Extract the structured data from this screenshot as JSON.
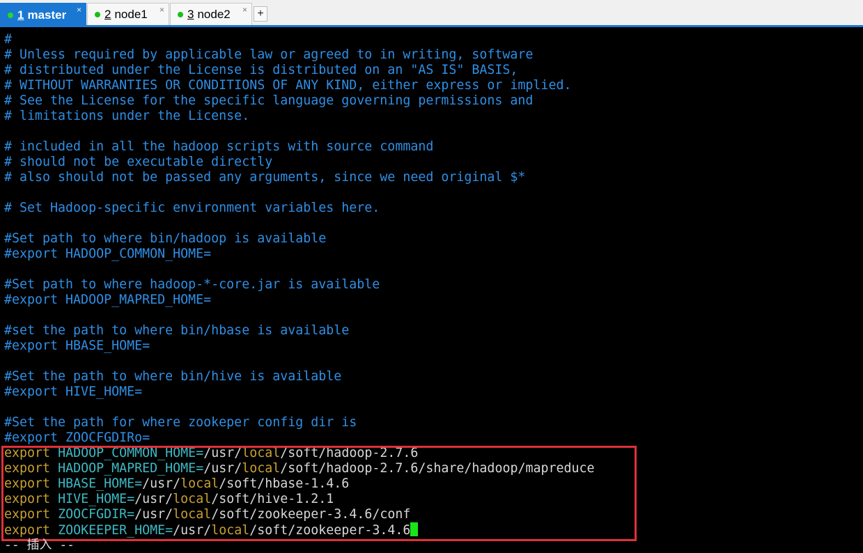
{
  "tabs": [
    {
      "num": "1",
      "label": "master",
      "close": "×"
    },
    {
      "num": "2",
      "label": "node1",
      "close": "×"
    },
    {
      "num": "3",
      "label": "node2",
      "close": "×"
    }
  ],
  "add_tab": "+",
  "comment_lines": [
    "#",
    "# Unless required by applicable law or agreed to in writing, software",
    "# distributed under the License is distributed on an \"AS IS\" BASIS,",
    "# WITHOUT WARRANTIES OR CONDITIONS OF ANY KIND, either express or implied.",
    "# See the License for the specific language governing permissions and",
    "# limitations under the License.",
    "",
    "# included in all the hadoop scripts with source command",
    "# should not be executable directly",
    "# also should not be passed any arguments, since we need original $*",
    "",
    "# Set Hadoop-specific environment variables here.",
    "",
    "#Set path to where bin/hadoop is available",
    "#export HADOOP_COMMON_HOME=",
    "",
    "#Set path to where hadoop-*-core.jar is available",
    "#export HADOOP_MAPRED_HOME=",
    "",
    "#set the path to where bin/hbase is available",
    "#export HBASE_HOME=",
    "",
    "#Set the path to where bin/hive is available",
    "#export HIVE_HOME=",
    "",
    "#Set the path for where zookeper config dir is",
    "#export ZOOCFGDIRo="
  ],
  "exports": [
    {
      "kw": "export",
      "var": "HADOOP_COMMON_HOME",
      "eq": "=",
      "p1": "/usr/",
      "loc": "local",
      "p2": "/soft/hadoop-2.7.6"
    },
    {
      "kw": "export",
      "var": "HADOOP_MAPRED_HOME",
      "eq": "=",
      "p1": "/usr/",
      "loc": "local",
      "p2": "/soft/hadoop-2.7.6/share/hadoop/mapreduce"
    },
    {
      "kw": "export",
      "var": "HBASE_HOME",
      "eq": "=",
      "p1": "/usr/",
      "loc": "local",
      "p2": "/soft/hbase-1.4.6"
    },
    {
      "kw": "export",
      "var": "HIVE_HOME",
      "eq": "=",
      "p1": "/usr/",
      "loc": "local",
      "p2": "/soft/hive-1.2.1"
    },
    {
      "kw": "export",
      "var": "ZOOCFGDIR",
      "eq": "=",
      "p1": "/usr/",
      "loc": "local",
      "p2": "/soft/zookeeper-3.4.6/conf"
    },
    {
      "kw": "export",
      "var": "ZOOKEEPER_HOME",
      "eq": "=",
      "p1": "/usr/",
      "loc": "local",
      "p2": "/soft/zookeeper-3.4.6"
    }
  ],
  "status_line": "-- 插入 --",
  "colors": {
    "comment": "#2f8fe6",
    "keyword": "#c8a032",
    "variable": "#3db9c4",
    "path": "#d8d8d8",
    "cursor": "#19e619",
    "highlight": "#e0313a",
    "tab_active": "#1a78d2",
    "status_dot": "#18c018"
  }
}
